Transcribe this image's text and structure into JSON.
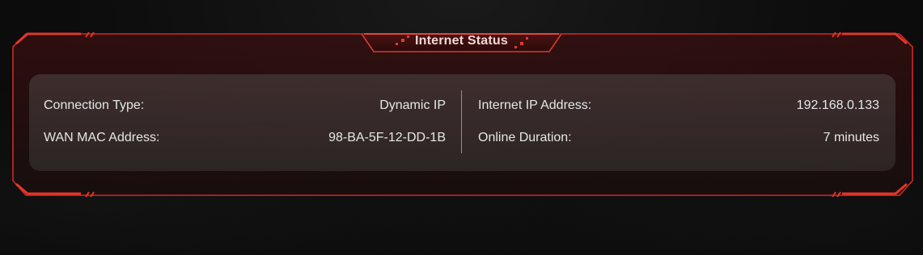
{
  "panel": {
    "title": "Internet Status",
    "accent_color": "#c4211b",
    "left": [
      {
        "label": "Connection Type:",
        "value": "Dynamic IP"
      },
      {
        "label": "WAN MAC Address:",
        "value": "98-BA-5F-12-DD-1B"
      }
    ],
    "right": [
      {
        "label": "Internet IP Address:",
        "value": "192.168.0.133"
      },
      {
        "label": "Online Duration:",
        "value": "7 minutes"
      }
    ]
  }
}
